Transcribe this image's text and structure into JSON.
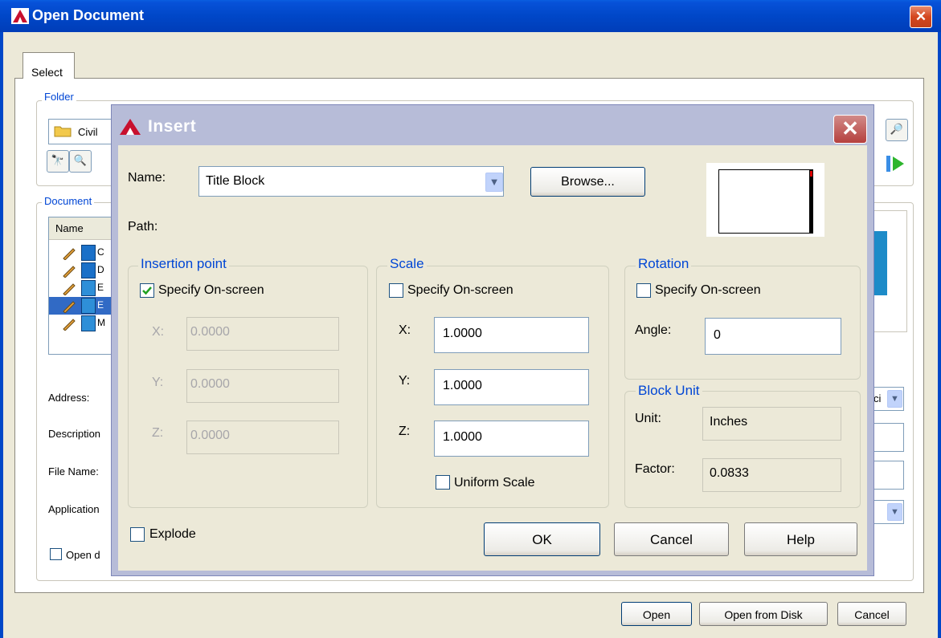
{
  "outer": {
    "title": "Open Document",
    "tab_select": "Select",
    "folder_legend": "Folder",
    "folder_value": "Civil",
    "document_legend": "Document",
    "list_header": "Name",
    "list_items": [
      "C",
      "D",
      "E",
      "E",
      "M"
    ],
    "address_label": "Address:",
    "description_label": "Description",
    "filename_label": "File Name:",
    "application_label": "Application",
    "address_partial": "ci",
    "open_checkbox_label": "Open d",
    "open_button": "Open",
    "open_from_disk_button": "Open from Disk",
    "cancel_button": "Cancel"
  },
  "insert": {
    "title": "Insert",
    "name_label": "Name:",
    "name_value": "Title Block",
    "browse_button": "Browse...",
    "path_label": "Path:",
    "insertion_point": {
      "legend": "Insertion point",
      "specify_label": "Specify On-screen",
      "specify_checked": true,
      "x_label": "X:",
      "x_value": "0.0000",
      "y_label": "Y:",
      "y_value": "0.0000",
      "z_label": "Z:",
      "z_value": "0.0000"
    },
    "scale": {
      "legend": "Scale",
      "specify_label": "Specify On-screen",
      "specify_checked": false,
      "x_label": "X:",
      "x_value": "1.0000",
      "y_label": "Y:",
      "y_value": "1.0000",
      "z_label": "Z:",
      "z_value": "1.0000",
      "uniform_label": "Uniform Scale",
      "uniform_checked": false
    },
    "rotation": {
      "legend": "Rotation",
      "specify_label": "Specify On-screen",
      "specify_checked": false,
      "angle_label": "Angle:",
      "angle_value": "0"
    },
    "block_unit": {
      "legend": "Block Unit",
      "unit_label": "Unit:",
      "unit_value": "Inches",
      "factor_label": "Factor:",
      "factor_value": "0.0833"
    },
    "explode_label": "Explode",
    "explode_checked": false,
    "ok_button": "OK",
    "cancel_button": "Cancel",
    "help_button": "Help"
  },
  "colors": {
    "xp_title_blue": "#0047C8",
    "insert_title_inactive": "#B7BCD8",
    "group_legend_blue": "#0046D5",
    "dialog_face": "#ECE9D8"
  }
}
